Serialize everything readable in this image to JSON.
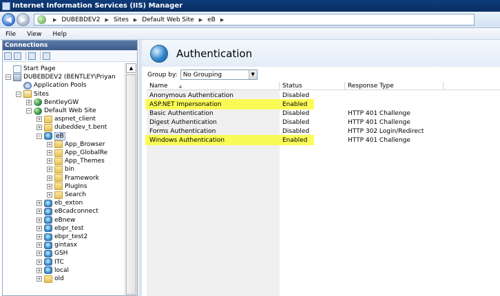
{
  "window": {
    "title": "Internet Information Services (IIS) Manager"
  },
  "address": {
    "breadcrumbs": [
      "DUBEBDEV2",
      "Sites",
      "Default Web Site",
      "eB"
    ]
  },
  "menu": {
    "items": [
      "File",
      "View",
      "Help"
    ]
  },
  "connections": {
    "header": "Connections",
    "tree": [
      {
        "label": "Start Page",
        "icon": "page-icon",
        "level": 0,
        "expander": ""
      },
      {
        "label": "DUBEBDEV2 (BENTLEY\\Priyan",
        "icon": "server-icon",
        "level": 0,
        "expander": "−"
      },
      {
        "label": "Application Pools",
        "icon": "app-pool-icon",
        "level": 1,
        "expander": ""
      },
      {
        "label": "Sites",
        "icon": "sites-folder-icon",
        "level": 1,
        "expander": "−"
      },
      {
        "label": "BentleyGW",
        "icon": "globe-icon",
        "level": 2,
        "expander": "+"
      },
      {
        "label": "Default Web Site",
        "icon": "globe-icon",
        "level": 2,
        "expander": "−"
      },
      {
        "label": "aspnet_client",
        "icon": "folder-icon",
        "level": 3,
        "expander": "+"
      },
      {
        "label": "dubeddev_t.bent",
        "icon": "folder-icon",
        "level": 3,
        "expander": "+"
      },
      {
        "label": "eB",
        "icon": "application-icon",
        "level": 3,
        "expander": "−",
        "selected": true
      },
      {
        "label": "App_Browser",
        "icon": "folder-icon",
        "level": 4,
        "expander": "+"
      },
      {
        "label": "App_GlobalRe",
        "icon": "folder-icon",
        "level": 4,
        "expander": "+"
      },
      {
        "label": "App_Themes",
        "icon": "folder-icon",
        "level": 4,
        "expander": "+"
      },
      {
        "label": "bin",
        "icon": "folder-icon",
        "level": 4,
        "expander": "+"
      },
      {
        "label": "Framework",
        "icon": "folder-icon",
        "level": 4,
        "expander": "+"
      },
      {
        "label": "PlugIns",
        "icon": "folder-icon",
        "level": 4,
        "expander": "+"
      },
      {
        "label": "Search",
        "icon": "folder-icon",
        "level": 4,
        "expander": "+"
      },
      {
        "label": "eb_exton",
        "icon": "application-icon",
        "level": 3,
        "expander": "+"
      },
      {
        "label": "eBcadconnect",
        "icon": "application-icon",
        "level": 3,
        "expander": "+"
      },
      {
        "label": "eBnew",
        "icon": "application-icon",
        "level": 3,
        "expander": "+"
      },
      {
        "label": "ebpr_test",
        "icon": "application-icon",
        "level": 3,
        "expander": "+"
      },
      {
        "label": "ebpr_test2",
        "icon": "application-icon",
        "level": 3,
        "expander": "+"
      },
      {
        "label": "gintasx",
        "icon": "application-icon",
        "level": 3,
        "expander": "+"
      },
      {
        "label": "GSH",
        "icon": "application-icon",
        "level": 3,
        "expander": "+"
      },
      {
        "label": "ITC",
        "icon": "application-icon",
        "level": 3,
        "expander": "+"
      },
      {
        "label": "local",
        "icon": "application-icon",
        "level": 3,
        "expander": "+"
      },
      {
        "label": "old",
        "icon": "folder-icon",
        "level": 3,
        "expander": "+"
      }
    ]
  },
  "feature": {
    "title": "Authentication",
    "group_by_label": "Group by:",
    "group_by_value": "No Grouping",
    "columns": [
      "Name",
      "Status",
      "Response Type"
    ],
    "rows": [
      {
        "name": "Anonymous Authentication",
        "status": "Disabled",
        "response": "",
        "highlighted": false
      },
      {
        "name": "ASP.NET Impersonation",
        "status": "Enabled",
        "response": "",
        "highlighted": true
      },
      {
        "name": "Basic Authentication",
        "status": "Disabled",
        "response": "HTTP 401 Challenge",
        "highlighted": false
      },
      {
        "name": "Digest Authentication",
        "status": "Disabled",
        "response": "HTTP 401 Challenge",
        "highlighted": false
      },
      {
        "name": "Forms Authentication",
        "status": "Disabled",
        "response": "HTTP 302 Login/Redirect",
        "highlighted": false
      },
      {
        "name": "Windows Authentication",
        "status": "Enabled",
        "response": "HTTP 401 Challenge",
        "highlighted": true
      }
    ]
  },
  "colors": {
    "highlight": "#fbfb3c",
    "titlebar": "#0f3b7a",
    "panel_header": "#4a6a98"
  }
}
